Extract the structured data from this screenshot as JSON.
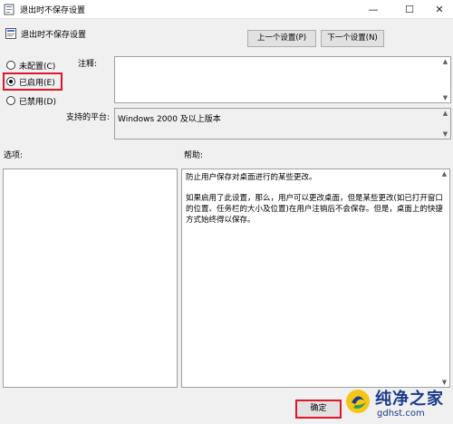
{
  "window": {
    "title": "退出时不保存设置",
    "min_glyph": "—",
    "max_glyph": "☐",
    "close_glyph": "✕"
  },
  "header": {
    "policy_name": "退出时不保存设置",
    "prev_button": "上一个设置(P)",
    "next_button": "下一个设置(N)"
  },
  "options_state": {
    "not_configured": "未配置(C)",
    "enabled": "已启用(E)",
    "disabled": "已禁用(D)",
    "selected": "enabled"
  },
  "labels": {
    "comment": "注释:",
    "platform": "支持的平台:",
    "options": "选项:",
    "help": "帮助:"
  },
  "platform_value": "Windows 2000 及以上版本",
  "help_text": {
    "p1": "防止用户保存对桌面进行的某些更改。",
    "p2": "如果启用了此设置，那么，用户可以更改桌面，但是某些更改(如已打开窗口的位置、任务栏的大小及位置)在用户注销后不会保存。但是，桌面上的快捷方式始终得以保存。"
  },
  "footer": {
    "ok_button": "确定"
  },
  "watermark": {
    "text": "纯净之家",
    "url": "gdhst.com"
  },
  "colors": {
    "highlight": "#e0162b",
    "watermark": "#1a3a8a"
  }
}
